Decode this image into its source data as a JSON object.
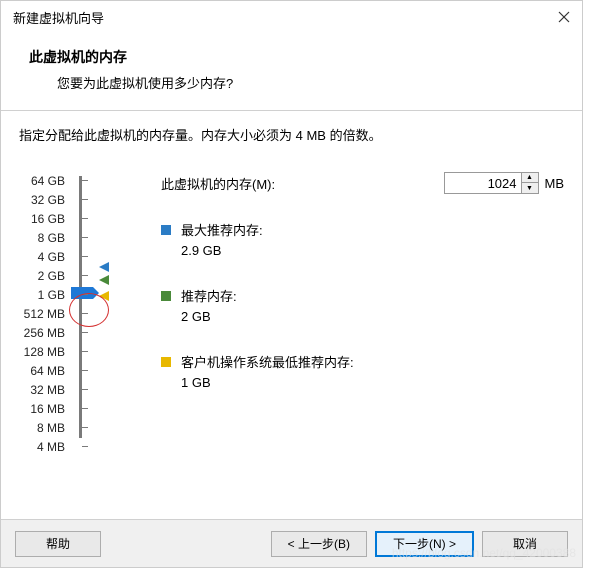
{
  "window": {
    "title": "新建虚拟机向导"
  },
  "header": {
    "title": "此虚拟机的内存",
    "subtitle": "您要为此虚拟机使用多少内存?"
  },
  "instruction": "指定分配给此虚拟机的内存量。内存大小必须为 4 MB 的倍数。",
  "memory": {
    "label": "此虚拟机的内存(M):",
    "value": "1024",
    "unit": "MB"
  },
  "slider_labels": [
    "64 GB",
    "32 GB",
    "16 GB",
    "8 GB",
    "4 GB",
    "2 GB",
    "1 GB",
    "512 MB",
    "256 MB",
    "128 MB",
    "64 MB",
    "32 MB",
    "16 MB",
    "8 MB",
    "4 MB"
  ],
  "recommend": {
    "max": {
      "label": "最大推荐内存:",
      "value": "2.9 GB"
    },
    "rec": {
      "label": "推荐内存:",
      "value": "2 GB"
    },
    "min": {
      "label": "客户机操作系统最低推荐内存:",
      "value": "1 GB"
    }
  },
  "buttons": {
    "help": "帮助",
    "back": "< 上一步(B)",
    "next": "下一步(N) >",
    "cancel": "取消"
  },
  "watermark": "https://blog.csdn.net/qq_42000388"
}
